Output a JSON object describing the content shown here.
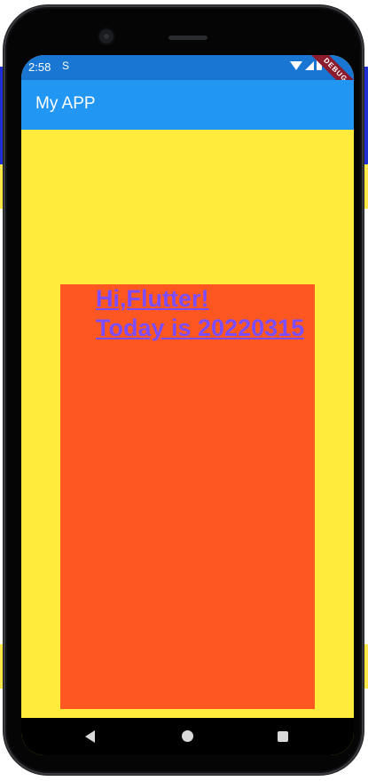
{
  "status_bar": {
    "time": "2:58",
    "sim_icon": "S",
    "debug_label": "DEBUG"
  },
  "app_bar": {
    "title": "My APP"
  },
  "content": {
    "line1": "Hi,Flutter!",
    "line2": "Today is 20220315"
  },
  "colors": {
    "status_bar": "#1976d2",
    "app_bar": "#2196f3",
    "background": "#ffeb3b",
    "box": "#ff5722",
    "text": "#7c4dff"
  },
  "nav_icons": [
    "back-icon",
    "home-icon",
    "recents-icon"
  ]
}
